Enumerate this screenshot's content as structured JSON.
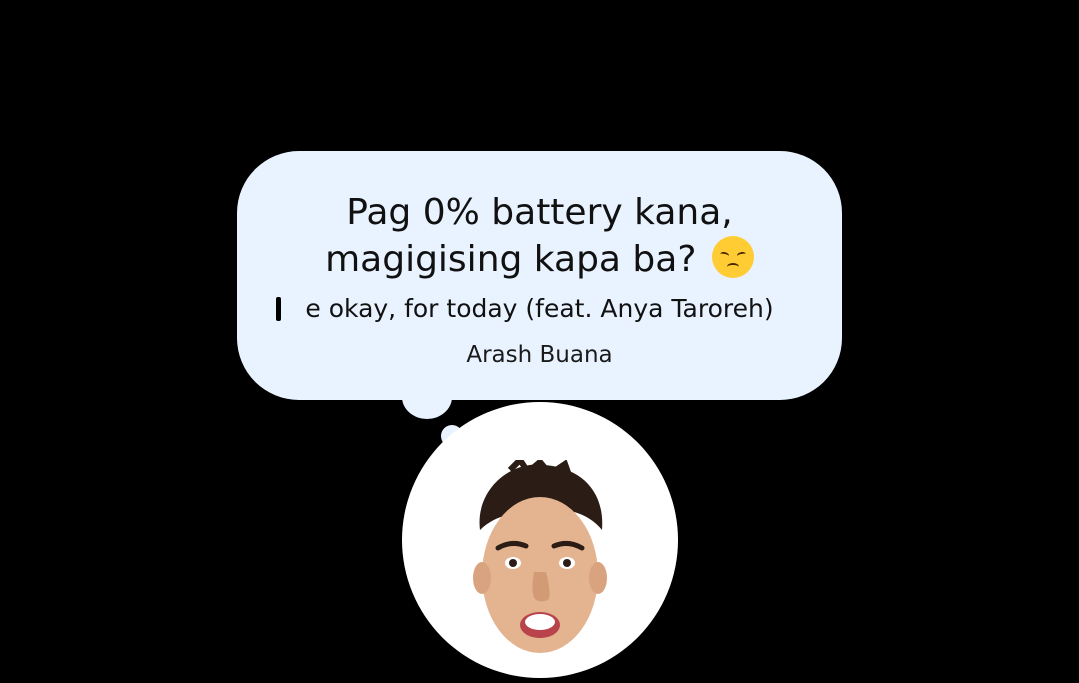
{
  "note": {
    "line1": "Pag 0% battery kana,",
    "line2": "magigising kapa ba?",
    "emoji": "disappointed-face-emoji"
  },
  "music": {
    "track": "e okay, for today (feat. Anya Taroreh)",
    "artist": "Arash Buana",
    "icon": "music-bars-icon"
  },
  "profile": {
    "avatar": "profile-avatar-photo"
  },
  "colors": {
    "background": "#000000",
    "bubble": "#e9f3ff",
    "text": "#111111"
  }
}
